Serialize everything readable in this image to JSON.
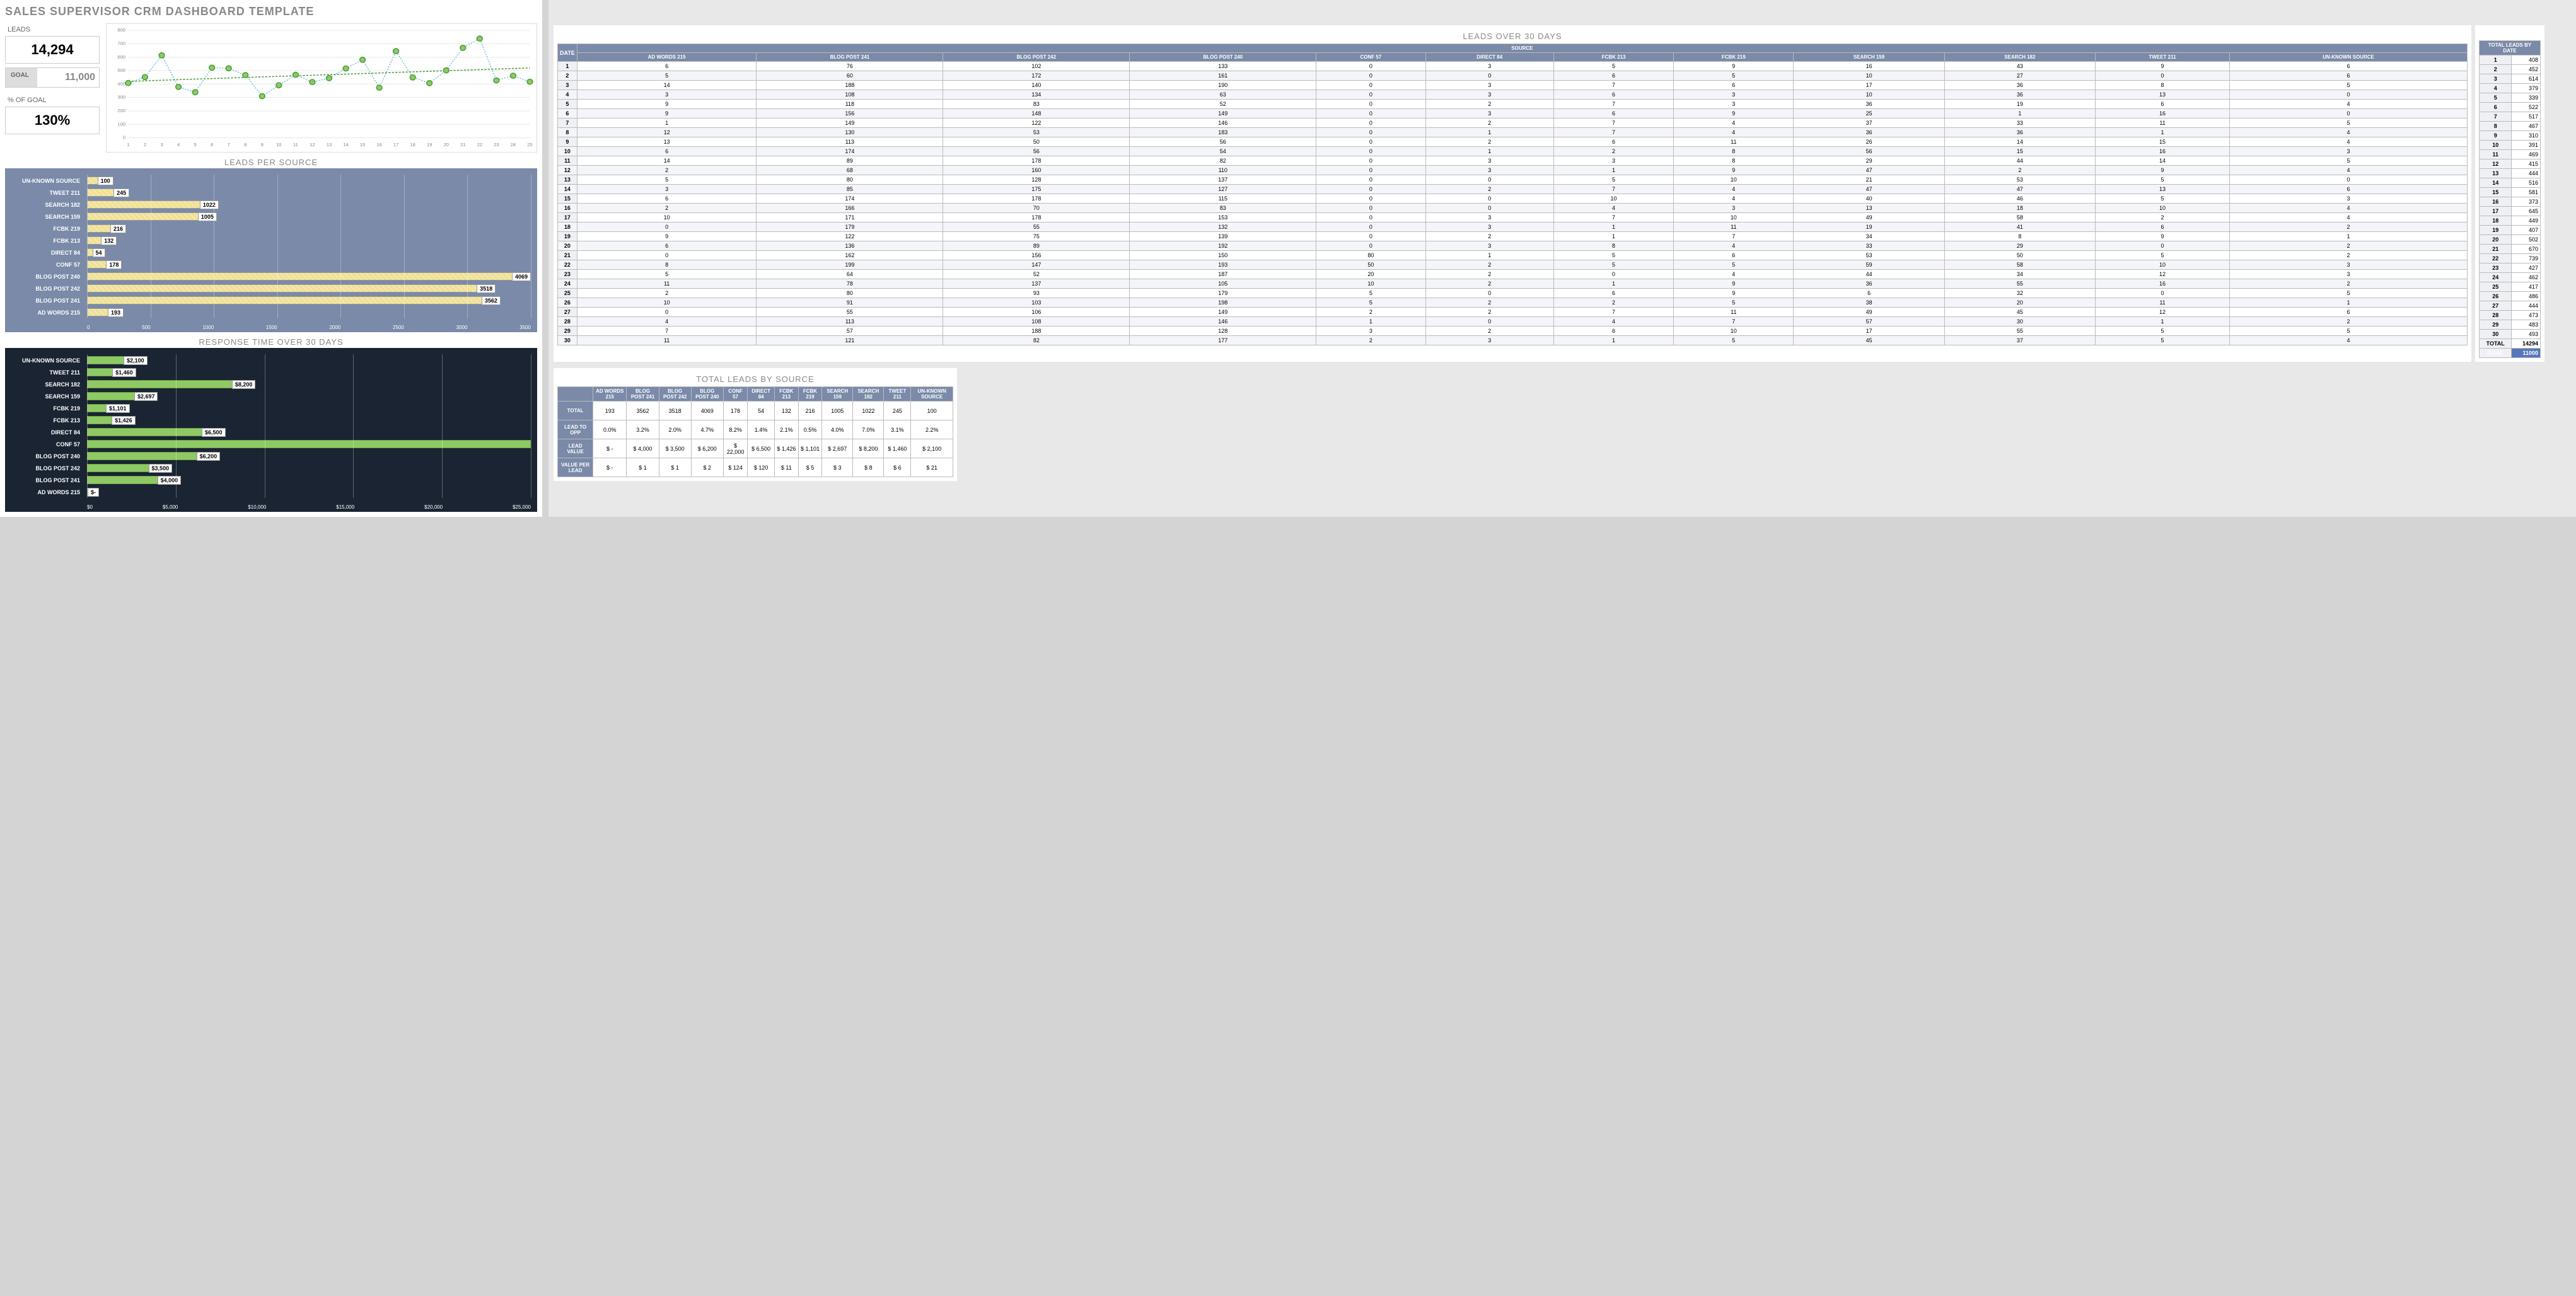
{
  "title": "SALES SUPERVISOR CRM DASHBOARD TEMPLATE",
  "kpi": {
    "leads_label": "LEADS",
    "leads_value": "14,294",
    "goal_label": "GOAL",
    "goal_value": "11,000",
    "pct_label": "% OF GOAL",
    "pct_value": "130%"
  },
  "sources": [
    "AD WORDS 215",
    "BLOG POST 241",
    "BLOG POST 242",
    "BLOG POST 240",
    "CONF 57",
    "DIRECT 84",
    "FCBK 213",
    "FCBK 219",
    "SEARCH 159",
    "SEARCH 182",
    "TWEET 211",
    "UN-KNOWN SOURCE"
  ],
  "sections": {
    "leads_per_source": "LEADS PER SOURCE",
    "response_time": "RESPONSE TIME OVER 30 DAYS",
    "leads_30": "LEADS OVER 30 DAYS",
    "source": "SOURCE",
    "date": "DATE",
    "total_by_source": "TOTAL LEADS BY SOURCE",
    "total_by_date": "TOTAL LEADS BY DATE",
    "total": "TOTAL",
    "goal": "GOAL",
    "lead_to_opp": "LEAD TO OPP",
    "lead_value": "LEAD VALUE",
    "value_per_lead": "VALUE PER LEAD"
  },
  "chart_data": {
    "line_chart": {
      "type": "line",
      "title": "",
      "x": [
        1,
        2,
        3,
        4,
        5,
        6,
        7,
        8,
        9,
        10,
        11,
        12,
        13,
        14,
        15,
        16,
        17,
        18,
        19,
        20,
        21,
        22,
        23,
        24,
        25
      ],
      "values": [
        408,
        452,
        614,
        379,
        339,
        522,
        517,
        467,
        310,
        391,
        469,
        415,
        444,
        516,
        581,
        373,
        645,
        449,
        407,
        502,
        670,
        739,
        427,
        462,
        417
      ],
      "ylim": [
        0,
        800
      ],
      "yticks": [
        0,
        100,
        200,
        300,
        400,
        500,
        600,
        700,
        800
      ]
    },
    "leads_per_source": {
      "type": "bar",
      "orientation": "horizontal",
      "categories": [
        "UN-KNOWN SOURCE",
        "TWEET 211",
        "SEARCH 182",
        "SEARCH 159",
        "FCBK 219",
        "FCBK 213",
        "DIRECT 84",
        "CONF 57",
        "BLOG POST 240",
        "BLOG POST 242",
        "BLOG POST 241",
        "AD WORDS 215"
      ],
      "values": [
        100,
        245,
        1022,
        1005,
        216,
        132,
        54,
        178,
        4069,
        3518,
        3562,
        193
      ],
      "xlim": [
        0,
        4000
      ],
      "xticks": [
        0,
        500,
        1000,
        1500,
        2000,
        2500,
        3000,
        3500
      ]
    },
    "response_time": {
      "type": "bar",
      "orientation": "horizontal",
      "categories": [
        "UN-KNOWN SOURCE",
        "TWEET 211",
        "SEARCH 182",
        "SEARCH 159",
        "FCBK 219",
        "FCBK 213",
        "DIRECT 84",
        "CONF 57",
        "BLOG POST 240",
        "BLOG POST 242",
        "BLOG POST 241",
        "AD WORDS 215"
      ],
      "values": [
        2100,
        1460,
        8200,
        2697,
        1101,
        1426,
        6500,
        25000,
        6200,
        3500,
        4000,
        0
      ],
      "labels": [
        "$2,100",
        "$1,460",
        "$8,200",
        "$2,697",
        "$1,101",
        "$1,426",
        "$6,500",
        "",
        "$6,200",
        "$3,500",
        "$4,000",
        "$-"
      ],
      "xlim": [
        0,
        25000
      ],
      "xticks": [
        "$0",
        "$5,000",
        "$10,000",
        "$15,000",
        "$20,000",
        "$25,000"
      ]
    }
  },
  "leads_table": [
    [
      6,
      76,
      102,
      133,
      0,
      3,
      5,
      9,
      16,
      43,
      9,
      6
    ],
    [
      5,
      60,
      172,
      161,
      0,
      0,
      6,
      5,
      10,
      27,
      0,
      6
    ],
    [
      14,
      188,
      140,
      190,
      0,
      3,
      7,
      6,
      17,
      36,
      8,
      5
    ],
    [
      3,
      108,
      134,
      63,
      0,
      3,
      6,
      3,
      10,
      36,
      13,
      0
    ],
    [
      9,
      118,
      83,
      52,
      0,
      2,
      7,
      3,
      36,
      19,
      6,
      4
    ],
    [
      9,
      156,
      148,
      149,
      0,
      3,
      6,
      9,
      25,
      1,
      16,
      0
    ],
    [
      1,
      149,
      122,
      146,
      0,
      2,
      7,
      4,
      37,
      33,
      11,
      5
    ],
    [
      12,
      130,
      53,
      183,
      0,
      1,
      7,
      4,
      36,
      36,
      1,
      4
    ],
    [
      13,
      113,
      50,
      56,
      0,
      2,
      6,
      11,
      26,
      14,
      15,
      4
    ],
    [
      6,
      174,
      56,
      54,
      0,
      1,
      2,
      8,
      56,
      15,
      16,
      3
    ],
    [
      14,
      89,
      178,
      82,
      0,
      3,
      3,
      8,
      29,
      44,
      14,
      5
    ],
    [
      2,
      68,
      160,
      110,
      0,
      3,
      1,
      9,
      47,
      2,
      9,
      4
    ],
    [
      5,
      80,
      128,
      137,
      0,
      0,
      5,
      10,
      21,
      53,
      5,
      0
    ],
    [
      3,
      85,
      175,
      127,
      0,
      2,
      7,
      4,
      47,
      47,
      13,
      6
    ],
    [
      6,
      174,
      178,
      115,
      0,
      0,
      10,
      4,
      40,
      46,
      5,
      3
    ],
    [
      2,
      166,
      70,
      83,
      0,
      0,
      4,
      3,
      13,
      18,
      10,
      4
    ],
    [
      10,
      171,
      178,
      153,
      0,
      3,
      7,
      10,
      49,
      58,
      2,
      4
    ],
    [
      0,
      179,
      55,
      132,
      0,
      3,
      1,
      11,
      19,
      41,
      6,
      2
    ],
    [
      9,
      122,
      75,
      139,
      0,
      2,
      1,
      7,
      34,
      8,
      9,
      1
    ],
    [
      6,
      136,
      89,
      192,
      0,
      3,
      8,
      4,
      33,
      29,
      0,
      2
    ],
    [
      0,
      162,
      156,
      150,
      80,
      1,
      5,
      6,
      53,
      50,
      5,
      2
    ],
    [
      8,
      199,
      147,
      193,
      50,
      2,
      5,
      5,
      59,
      58,
      10,
      3
    ],
    [
      5,
      64,
      52,
      187,
      20,
      2,
      0,
      4,
      44,
      34,
      12,
      3
    ],
    [
      11,
      78,
      137,
      105,
      10,
      2,
      1,
      9,
      36,
      55,
      16,
      2
    ],
    [
      2,
      80,
      93,
      179,
      5,
      0,
      6,
      9,
      6,
      32,
      0,
      5
    ],
    [
      10,
      91,
      103,
      198,
      5,
      2,
      2,
      5,
      38,
      20,
      11,
      1
    ],
    [
      0,
      55,
      106,
      149,
      2,
      2,
      7,
      11,
      49,
      45,
      12,
      6
    ],
    [
      4,
      113,
      108,
      146,
      1,
      0,
      4,
      7,
      57,
      30,
      1,
      2
    ],
    [
      7,
      57,
      188,
      128,
      3,
      2,
      6,
      10,
      17,
      55,
      5,
      5
    ],
    [
      11,
      121,
      82,
      177,
      2,
      3,
      1,
      5,
      45,
      37,
      5,
      4
    ]
  ],
  "totals_by_date": [
    408,
    452,
    614,
    379,
    339,
    522,
    517,
    467,
    310,
    391,
    469,
    415,
    444,
    516,
    581,
    373,
    645,
    449,
    407,
    502,
    670,
    739,
    427,
    462,
    417,
    486,
    444,
    473,
    483,
    493
  ],
  "totals_sum": "14294",
  "goal_total": "11000",
  "totals_by_source": {
    "total": [
      "193",
      "3562",
      "3518",
      "4069",
      "178",
      "54",
      "132",
      "216",
      "1005",
      "1022",
      "245",
      "100"
    ],
    "lead_to_opp": [
      "0.0%",
      "3.2%",
      "2.0%",
      "4.7%",
      "8.2%",
      "1.4%",
      "2.1%",
      "0.5%",
      "4.0%",
      "7.0%",
      "3.1%",
      "2.2%"
    ],
    "lead_value": [
      "$    -",
      "$   4,000",
      "$   3,500",
      "$   6,200",
      "$  22,000",
      "$   6,500",
      "$   1,426",
      "$   1,101",
      "$   2,697",
      "$   8,200",
      "$   1,460",
      "$   2,100"
    ],
    "value_per_lead": [
      "$    -",
      "$        1",
      "$        1",
      "$        2",
      "$     124",
      "$     120",
      "$       11",
      "$        5",
      "$        3",
      "$        8",
      "$        6",
      "$       21"
    ]
  }
}
